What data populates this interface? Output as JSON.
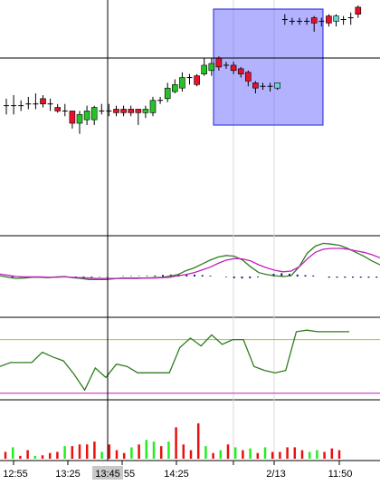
{
  "chart_data": [
    {
      "panel": "price",
      "type": "candlestick",
      "title": "",
      "ylim": [
        0,
        100
      ],
      "candles": [
        {
          "o": 43,
          "c": 43,
          "h": 47,
          "l": 38,
          "fill": "none"
        },
        {
          "o": 43,
          "c": 43,
          "h": 49,
          "l": 38,
          "fill": "none"
        },
        {
          "o": 43,
          "c": 43,
          "h": 46,
          "l": 40,
          "fill": "none"
        },
        {
          "o": 44,
          "c": 44,
          "h": 48,
          "l": 41,
          "fill": "none"
        },
        {
          "o": 44,
          "c": 44,
          "h": 50,
          "l": 41,
          "fill": "none"
        },
        {
          "o": 47,
          "c": 44,
          "h": 49,
          "l": 42,
          "fill": "red"
        },
        {
          "o": 44,
          "c": 44,
          "h": 47,
          "l": 40,
          "fill": "none"
        },
        {
          "o": 42,
          "c": 40,
          "h": 44,
          "l": 39,
          "fill": "red"
        },
        {
          "o": 40,
          "c": 40,
          "h": 44,
          "l": 37,
          "fill": "none"
        },
        {
          "o": 40,
          "c": 33,
          "h": 40,
          "l": 30,
          "fill": "red"
        },
        {
          "o": 33,
          "c": 38,
          "h": 40,
          "l": 27,
          "fill": "green"
        },
        {
          "o": 35,
          "c": 40,
          "h": 43,
          "l": 32,
          "fill": "green"
        },
        {
          "o": 35,
          "c": 42,
          "h": 43,
          "l": 32,
          "fill": "green"
        },
        {
          "o": 40,
          "c": 40,
          "h": 44,
          "l": 38,
          "fill": "none"
        },
        {
          "o": 40,
          "c": 40,
          "h": 44,
          "l": 37,
          "fill": "none"
        },
        {
          "o": 41,
          "c": 39,
          "h": 43,
          "l": 37,
          "fill": "red"
        },
        {
          "o": 41,
          "c": 39,
          "h": 43,
          "l": 37,
          "fill": "red"
        },
        {
          "o": 41,
          "c": 39,
          "h": 43,
          "l": 37,
          "fill": "red"
        },
        {
          "o": 41,
          "c": 39,
          "h": 41,
          "l": 32,
          "fill": "red"
        },
        {
          "o": 39,
          "c": 41,
          "h": 43,
          "l": 36,
          "fill": "green"
        },
        {
          "o": 39,
          "c": 46,
          "h": 48,
          "l": 37,
          "fill": "green"
        },
        {
          "o": 46,
          "c": 46,
          "h": 48,
          "l": 44,
          "fill": "none"
        },
        {
          "o": 47,
          "c": 53,
          "h": 56,
          "l": 45,
          "fill": "green"
        },
        {
          "o": 51,
          "c": 55,
          "h": 58,
          "l": 50,
          "fill": "green"
        },
        {
          "o": 53,
          "c": 59,
          "h": 62,
          "l": 51,
          "fill": "green"
        },
        {
          "o": 59,
          "c": 59,
          "h": 61,
          "l": 55,
          "fill": "none"
        },
        {
          "o": 60,
          "c": 55,
          "h": 61,
          "l": 54,
          "fill": "red"
        },
        {
          "o": 61,
          "c": 66,
          "h": 70,
          "l": 60,
          "fill": "green"
        },
        {
          "o": 63,
          "c": 67,
          "h": 70,
          "l": 60,
          "fill": "green"
        },
        {
          "o": 70,
          "c": 65,
          "h": 71,
          "l": 63,
          "fill": "red"
        },
        {
          "o": 66,
          "c": 66,
          "h": 68,
          "l": 64,
          "fill": "none"
        },
        {
          "o": 66,
          "c": 63,
          "h": 68,
          "l": 61,
          "fill": "red"
        },
        {
          "o": 64,
          "c": 61,
          "h": 65,
          "l": 59,
          "fill": "red"
        },
        {
          "o": 62,
          "c": 57,
          "h": 63,
          "l": 54,
          "fill": "red"
        },
        {
          "o": 56,
          "c": 53,
          "h": 57,
          "l": 50,
          "fill": "red"
        },
        {
          "o": 54,
          "c": 54,
          "h": 56,
          "l": 52,
          "fill": "none"
        },
        {
          "o": 54,
          "c": 54,
          "h": 56,
          "l": 51,
          "fill": "none"
        },
        {
          "o": 53,
          "c": 56,
          "h": 56,
          "l": 52,
          "fill": "cyan"
        },
        {
          "o": 92,
          "c": 92,
          "h": 95,
          "l": 89,
          "fill": "none"
        },
        {
          "o": 91,
          "c": 91,
          "h": 93,
          "l": 89,
          "fill": "none"
        },
        {
          "o": 91,
          "c": 91,
          "h": 93,
          "l": 89,
          "fill": "none"
        },
        {
          "o": 91,
          "c": 91,
          "h": 93,
          "l": 89,
          "fill": "none"
        },
        {
          "o": 90,
          "c": 93,
          "h": 94,
          "l": 85,
          "fill": "red"
        },
        {
          "o": 91,
          "c": 91,
          "h": 93,
          "l": 88,
          "fill": "none"
        },
        {
          "o": 90,
          "c": 94,
          "h": 95,
          "l": 88,
          "fill": "red"
        },
        {
          "o": 91,
          "c": 94,
          "h": 95,
          "l": 88,
          "fill": "cyan"
        },
        {
          "o": 92,
          "c": 92,
          "h": 94,
          "l": 89,
          "fill": "none"
        },
        {
          "o": 93,
          "c": 93,
          "h": 96,
          "l": 89,
          "fill": "none"
        },
        {
          "o": 95,
          "c": 99,
          "h": 100,
          "l": 93,
          "fill": "red"
        }
      ]
    },
    {
      "panel": "macd",
      "type": "line",
      "title": "",
      "ylim": [
        -1,
        1
      ],
      "series": [
        {
          "color": "#2e7d1e",
          "values": [
            0.02,
            -0.02,
            -0.05,
            -0.04,
            -0.02,
            -0.02,
            -0.03,
            -0.01,
            0.0,
            -0.03,
            -0.05,
            -0.08,
            -0.08,
            -0.08,
            -0.06,
            -0.04,
            -0.04,
            -0.04,
            -0.04,
            -0.03,
            -0.02,
            0.01,
            0.05,
            0.15,
            0.22,
            0.32,
            0.42,
            0.5,
            0.54,
            0.52,
            0.42,
            0.25,
            0.1,
            0.05,
            0.02,
            0.0,
            0.02,
            0.25,
            0.6,
            0.78,
            0.85,
            0.83,
            0.8,
            0.72,
            0.62,
            0.52,
            0.4,
            0.3
          ]
        },
        {
          "color": "#c020c0",
          "values": [
            0.06,
            0.03,
            0.0,
            -0.01,
            -0.01,
            -0.01,
            -0.02,
            -0.02,
            -0.01,
            -0.02,
            -0.03,
            -0.04,
            -0.05,
            -0.05,
            -0.05,
            -0.05,
            -0.05,
            -0.05,
            -0.04,
            -0.04,
            -0.03,
            -0.02,
            0.02,
            0.05,
            0.1,
            0.17,
            0.24,
            0.34,
            0.42,
            0.46,
            0.45,
            0.4,
            0.3,
            0.22,
            0.16,
            0.12,
            0.14,
            0.25,
            0.45,
            0.62,
            0.7,
            0.72,
            0.72,
            0.7,
            0.66,
            0.62,
            0.56,
            0.48
          ]
        }
      ],
      "histogram": [
        0,
        -0.2,
        -0.1,
        -0.07,
        -0.05,
        0,
        -0.05,
        0,
        -0.05,
        -0.1,
        -0.15,
        -0.1,
        -0.05,
        -0.05,
        0,
        0.05,
        0.05,
        0.05,
        0.08,
        0.12,
        0.2,
        0.25,
        0.3,
        0.3,
        0.25,
        0.18,
        0.1,
        0,
        -0.08,
        -0.22,
        -0.25,
        -0.22,
        -0.1,
        0,
        0.35,
        0.42,
        0.35,
        0.25,
        0.18,
        0.12,
        0,
        -0.15,
        -0.15,
        -0.15,
        -0.15,
        -0.15,
        -0.15,
        -0.15
      ]
    },
    {
      "panel": "oscillator",
      "type": "line",
      "title": "",
      "ylim": [
        0,
        100
      ],
      "levels": [
        {
          "value": 74,
          "color": "#b6c218"
        },
        {
          "value": 6,
          "color": "#c020c0"
        }
      ],
      "series": [
        {
          "color": "#2e7d1e",
          "values": [
            40,
            45,
            45,
            45,
            58,
            52,
            47,
            30,
            10,
            38,
            26,
            43,
            40,
            32,
            32,
            32,
            32,
            64,
            76,
            66,
            80,
            68,
            74,
            74,
            40,
            35,
            32,
            35,
            84,
            86,
            84,
            84,
            84,
            84
          ]
        }
      ]
    },
    {
      "panel": "volume",
      "type": "bar",
      "title": "",
      "ylim": [
        0,
        100
      ],
      "values": [
        12,
        20,
        5,
        15,
        5,
        6,
        10,
        12,
        22,
        22,
        25,
        25,
        30,
        12,
        25,
        15,
        10,
        20,
        25,
        33,
        30,
        22,
        30,
        55,
        25,
        15,
        62,
        22,
        10,
        15,
        25,
        20,
        15,
        18,
        10,
        20,
        12,
        12,
        20,
        20,
        15,
        12,
        15,
        12,
        18,
        15
      ],
      "colors": [
        "red",
        "lime",
        "red",
        "red",
        "lime",
        "red",
        "red",
        "red",
        "lime",
        "red",
        "red",
        "red",
        "red",
        "lime",
        "red",
        "red",
        "red",
        "lime",
        "red",
        "lime",
        "lime",
        "red",
        "lime",
        "red",
        "red",
        "red",
        "red",
        "lime",
        "red",
        "lime",
        "red",
        "lime",
        "red",
        "lime",
        "red",
        "lime",
        "red",
        "red",
        "red",
        "red",
        "red",
        "lime",
        "lime",
        "red",
        "red",
        "red"
      ]
    }
  ],
  "x_axis": {
    "tick_labels": [
      "12:55",
      "13:25",
      "13:45",
      "55",
      "14:25",
      "2/13",
      "11:50"
    ],
    "crosshair_label": "13:45"
  },
  "selection_box": {
    "color": "#6666ff"
  }
}
